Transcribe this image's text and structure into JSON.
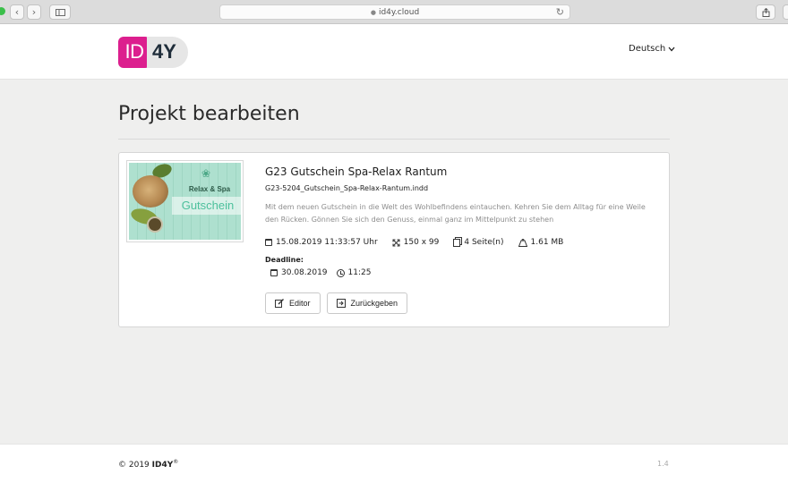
{
  "browser": {
    "url": "id4y.cloud",
    "back_icon": "chevron-left",
    "forward_icon": "chevron-right",
    "sidebar_icon": "sidebar-toggle",
    "reload_icon": "reload",
    "share_icon": "share"
  },
  "header": {
    "logo_left": "ID",
    "logo_right": "4Y",
    "language": "Deutsch"
  },
  "page": {
    "title": "Projekt bearbeiten"
  },
  "project": {
    "thumb_line1": "Relax & Spa",
    "thumb_line2": "Gutschein",
    "name": "G23 Gutschein Spa-Relax Rantum",
    "file": "G23-5204_Gutschein_Spa-Relax-Rantum.indd",
    "description": "Mit dem neuen Gutschein in die Welt des Wohlbefindens eintauchen. Kehren Sie dem Alltag für eine Weile den Rücken. Gönnen Sie sich den Genuss, einmal ganz im Mittelpunkt zu stehen",
    "date": "15.08.2019 11:33:57 Uhr",
    "dimensions": "150 x 99",
    "pages": "4 Seite(n)",
    "size": "1.61 MB",
    "deadline_label": "Deadline:",
    "deadline_date": "30.08.2019",
    "deadline_time": "11:25",
    "editor_button": "Editor",
    "return_button": "Zurückgeben"
  },
  "footer": {
    "copyright_prefix": "© 2019",
    "brand": "ID4Y",
    "registered": "®",
    "version": "1.4"
  },
  "colors": {
    "brand_pink": "#dc1f8e",
    "brand_dark": "#1f2d3a",
    "page_background": "#efefee",
    "thumb_green": "#4cc09c"
  }
}
